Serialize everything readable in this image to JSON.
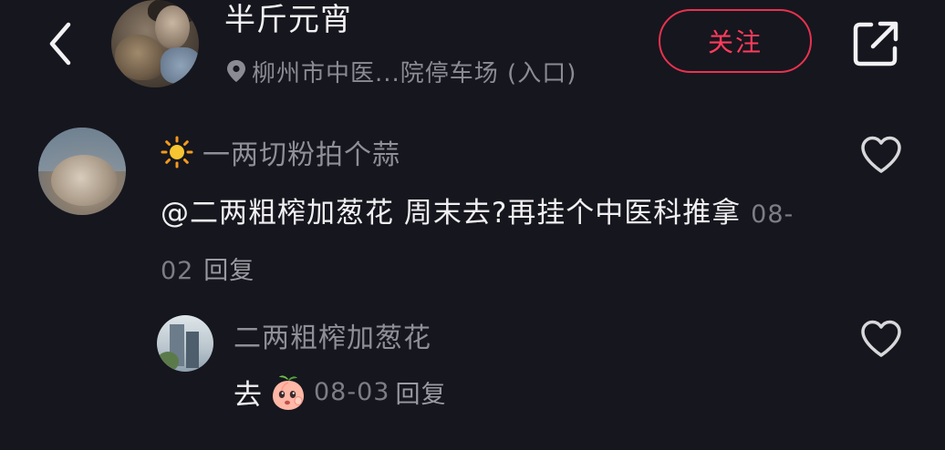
{
  "header": {
    "username": "半斤元宵",
    "location": "柳州市中医...院停车场 (入口)",
    "follow_label": "关注",
    "icons": {
      "back": "chevron-left-icon",
      "share": "share-external-icon",
      "location": "location-pin-icon"
    }
  },
  "comments": [
    {
      "name_prefix_icon": "sun-icon",
      "name": "一两切粉拍个蒜",
      "text": "@二两粗榨加葱花 周末去?再挂个中医科推拿",
      "date": "08-02",
      "reply_label": "回复",
      "like_icon": "heart-outline-icon"
    },
    {
      "name": "二两粗榨加葱花",
      "text": "去",
      "emoji": "peach-emoji-icon",
      "date": "08-03",
      "reply_label": "回复",
      "like_icon": "heart-outline-icon"
    }
  ],
  "colors": {
    "background": "#16161e",
    "accent": "#ff3b5c",
    "secondary_text": "#8f8f97"
  }
}
